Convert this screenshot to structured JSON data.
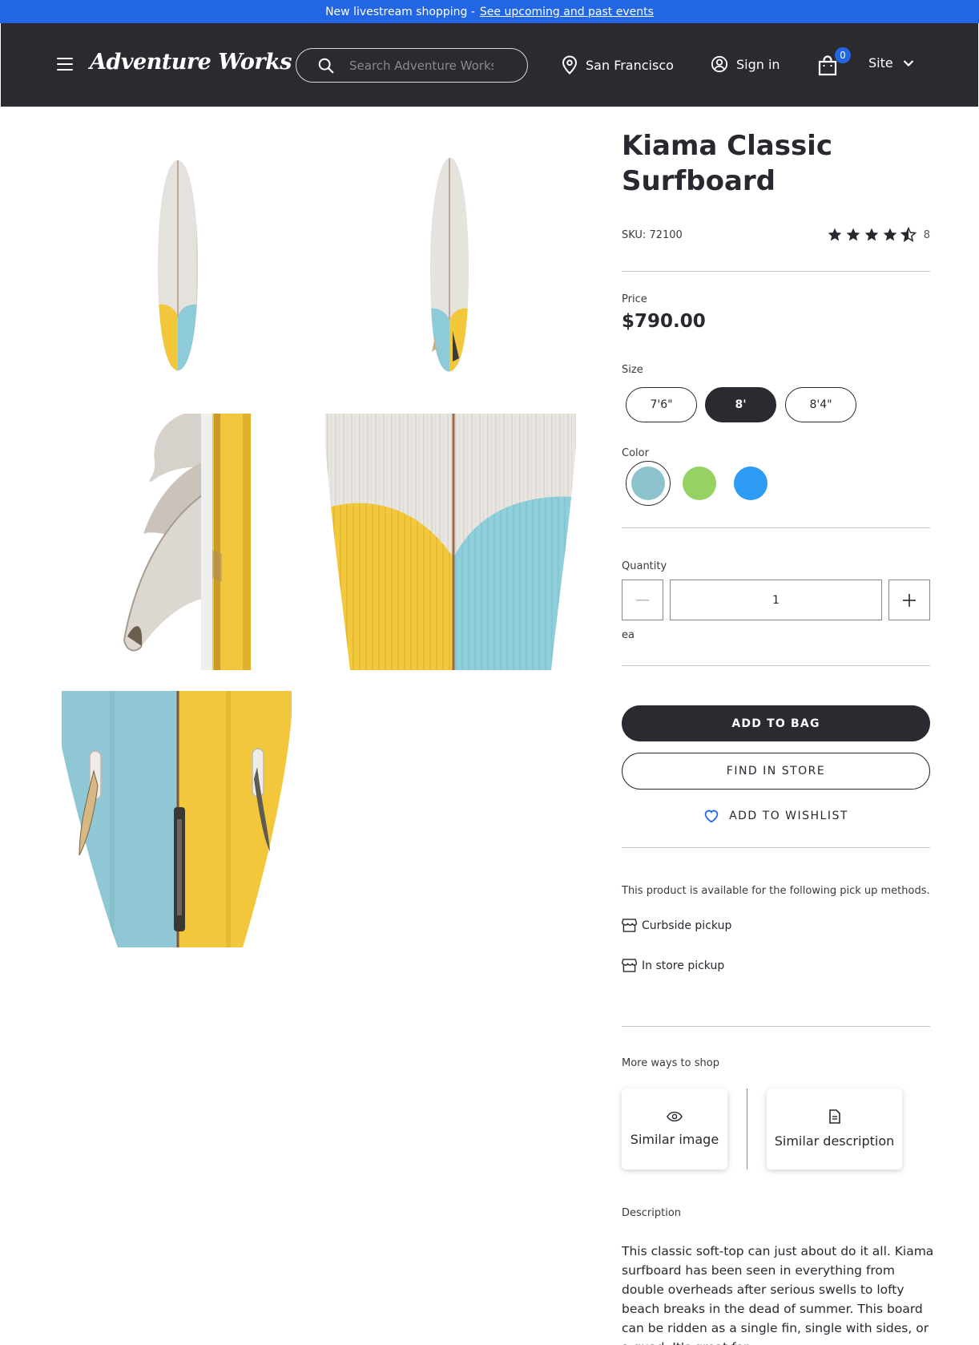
{
  "promo": {
    "text": "New livestream shopping -",
    "link": "See upcoming and past events"
  },
  "header": {
    "logo": "Adventure Works",
    "search_placeholder": "Search Adventure Works",
    "location": "San Francisco",
    "sign_in": "Sign in",
    "cart_count": "0",
    "site": "Site"
  },
  "product": {
    "title": "Kiama Classic Surfboard",
    "sku": "SKU: 72100",
    "rating": 4.5,
    "review_count": "8",
    "price_label": "Price",
    "price": "$790.00",
    "size_label": "Size",
    "sizes": [
      "7'6\"",
      "8'",
      "8'4\""
    ],
    "selected_size": "8'",
    "color_label": "Color",
    "colors": [
      "#8dc3cd",
      "#96d163",
      "#2e9bf5"
    ],
    "selected_color": "#8dc3cd",
    "quantity_label": "Quantity",
    "quantity": "1",
    "unit": "ea",
    "add_to_bag": "ADD TO BAG",
    "find_in_store": "FIND IN STORE",
    "add_to_wishlist": "ADD TO WISHLIST"
  },
  "pickup": {
    "note": "This product is available for the following pick up methods.",
    "methods": [
      "Curbside pickup",
      "In store pickup"
    ]
  },
  "more_ways": {
    "label": "More ways to shop",
    "options": [
      "Similar image",
      "Similar description"
    ]
  },
  "description": {
    "label": "Description",
    "text": "This classic soft-top can just about do it all. Kiama surfboard has been seen in everything from double overheads after serious swells to lofty beach breaks in the dead of summer. This board can be ridden as a single fin, single with sides, or a quad. It's great for"
  },
  "board_colors": {
    "wood": "#e4e0db",
    "yellow": "#f0c63a",
    "blue": "#8dccd8"
  }
}
